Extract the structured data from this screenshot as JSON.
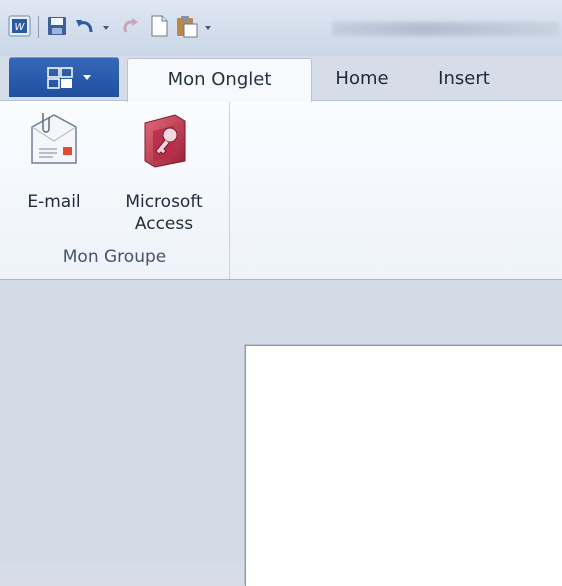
{
  "quick_access": {
    "icons": [
      "word-app-icon",
      "save-icon",
      "undo-icon",
      "redo-icon",
      "new-document-icon",
      "paste-icon",
      "customize-dropdown-icon"
    ]
  },
  "tabs": {
    "file_icon": "ribbon-file-menu-icon",
    "items": [
      {
        "label": "Mon Onglet",
        "active": true
      },
      {
        "label": "Home",
        "active": false
      },
      {
        "label": "Insert",
        "active": false
      }
    ]
  },
  "ribbon": {
    "groups": [
      {
        "label": "Mon Groupe",
        "buttons": [
          {
            "label": "E-mail",
            "icon": "email-icon"
          },
          {
            "label_line1": "Microsoft",
            "label_line2": "Access",
            "icon": "microsoft-access-icon"
          }
        ]
      }
    ]
  },
  "colors": {
    "file_tab": "#2a5caa",
    "ribbon_bg": "#f4f7fb",
    "workspace_bg": "#d3dbe6",
    "access_icon": "#c2384f"
  }
}
